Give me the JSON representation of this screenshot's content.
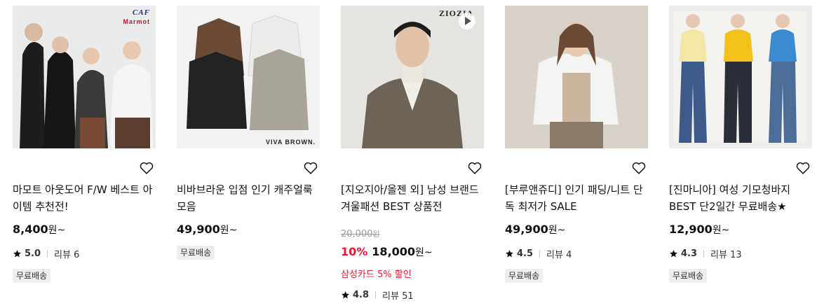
{
  "products": [
    {
      "brand_mark": "CAF",
      "brand_mark2": "Marmot",
      "title": "마모트 아웃도어 F/W 베스트 아이템 추천전!",
      "price": "8,400",
      "won": "원~",
      "rating": "5.0",
      "review_label": "리뷰 6",
      "badge": "무료배송"
    },
    {
      "brand_mark": "VIVA BROWN.",
      "title": "비바브라운 입점 인기 캐주얼룩 모음",
      "price": "49,900",
      "won": "원~",
      "badge": "무료배송"
    },
    {
      "brand_mark": "ZIOZIA",
      "title": "[지오지아/올젠 외] 남성 브랜드 겨울패션 BEST 상품전",
      "original_price": "20,000",
      "original_won": "원",
      "discount": "10%",
      "price": "18,000",
      "won": "원~",
      "promo": "삼성카드 5% 할인",
      "rating": "4.8",
      "review_label": "리뷰 51"
    },
    {
      "title": "[부루앤쥬디] 인기 패딩/니트 단독 최저가 SALE",
      "price": "49,900",
      "won": "원~",
      "rating": "4.5",
      "review_label": "리뷰 4",
      "badge": "무료배송"
    },
    {
      "title": "[진마니아] 여성 기모청바지 BEST 단2일간 무료배송★",
      "price": "12,900",
      "won": "원~",
      "rating": "4.3",
      "review_label": "리뷰 13",
      "badge": "무료배송"
    }
  ],
  "colors": {
    "discount": "#f0162f",
    "badge_bg": "#eeeeee",
    "muted": "#999999"
  }
}
